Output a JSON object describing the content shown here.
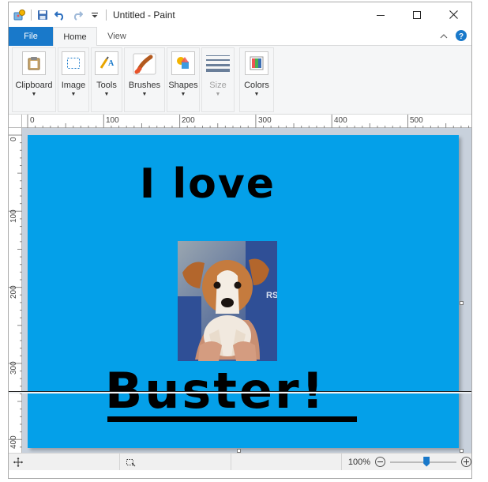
{
  "window": {
    "title": "Untitled - Paint"
  },
  "tabs": {
    "file": "File",
    "home": "Home",
    "view": "View"
  },
  "ribbon": {
    "groups": [
      {
        "label": "Clipboard",
        "icon": "clipboard-icon",
        "enabled": true
      },
      {
        "label": "Image",
        "icon": "select-icon",
        "enabled": true
      },
      {
        "label": "Tools",
        "icon": "tools-icon",
        "enabled": true
      },
      {
        "label": "Brushes",
        "icon": "brush-icon",
        "enabled": true
      },
      {
        "label": "Shapes",
        "icon": "shapes-icon",
        "enabled": true
      },
      {
        "label": "Size",
        "icon": "size-lines-icon",
        "enabled": false
      },
      {
        "label": "Colors",
        "icon": "palette-icon",
        "enabled": true
      }
    ],
    "dropdown_arrow": "▼"
  },
  "rulers": {
    "horizontal": [
      "0",
      "100",
      "200",
      "300",
      "400",
      "500"
    ],
    "vertical": [
      "0",
      "100",
      "200",
      "300",
      "400"
    ]
  },
  "canvas": {
    "background": "#04a0e9",
    "text_line1": "I love",
    "text_line2": "Buster!",
    "photo": "puppy-photo"
  },
  "statusbar": {
    "zoom": "100%",
    "zoom_level": 0.55
  },
  "colors": {
    "accent": "#1979ca",
    "canvas_blue": "#04a0e9"
  }
}
